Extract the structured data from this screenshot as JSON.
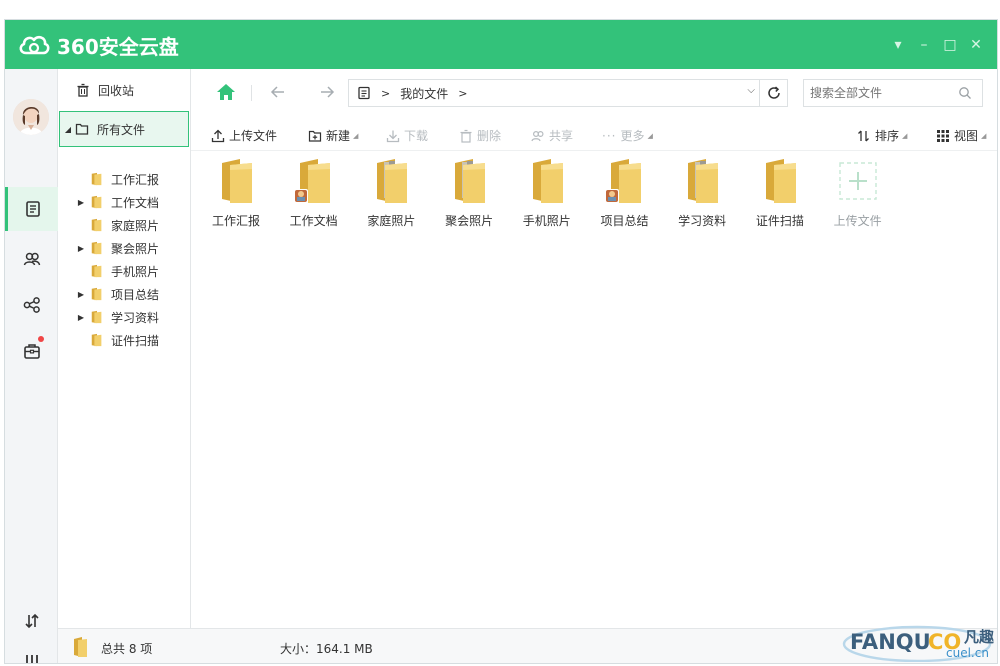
{
  "app": {
    "title": "360安全云盘"
  },
  "window": {
    "menu_glyph": "▾",
    "minimize_glyph": "–",
    "maximize_glyph": "□",
    "close_glyph": "✕"
  },
  "tree": {
    "recycle_bin": "回收站",
    "root": "所有文件",
    "items": [
      {
        "label": "工作汇报",
        "expandable": false
      },
      {
        "label": "工作文档",
        "expandable": true
      },
      {
        "label": "家庭照片",
        "expandable": false
      },
      {
        "label": "聚会照片",
        "expandable": true
      },
      {
        "label": "手机照片",
        "expandable": false
      },
      {
        "label": "项目总结",
        "expandable": true
      },
      {
        "label": "学习资料",
        "expandable": true
      },
      {
        "label": "证件扫描",
        "expandable": false
      }
    ]
  },
  "address": {
    "path_separator": ">",
    "current": "我的文件",
    "trailing_separator": ">",
    "search_placeholder": "搜索全部文件"
  },
  "toolbar": {
    "upload": "上传文件",
    "new": "新建",
    "download": "下载",
    "delete": "删除",
    "share": "共享",
    "more": "更多",
    "sort": "排序",
    "view": "视图"
  },
  "files": [
    {
      "name": "工作汇报",
      "variant": "plain"
    },
    {
      "name": "工作文档",
      "variant": "badge"
    },
    {
      "name": "家庭照片",
      "variant": "docs"
    },
    {
      "name": "聚会照片",
      "variant": "docs"
    },
    {
      "name": "手机照片",
      "variant": "plain"
    },
    {
      "name": "项目总结",
      "variant": "badge"
    },
    {
      "name": "学习资料",
      "variant": "docs"
    },
    {
      "name": "证件扫描",
      "variant": "plain"
    }
  ],
  "upload_tile": {
    "label": "上传文件"
  },
  "status": {
    "total": "总共 8 项",
    "size": "大小：164.1 MB"
  },
  "watermark": {
    "brand": "FANQU",
    "suffix": "CO",
    "domain": "cuel.cn",
    "cn": "凡趣"
  },
  "colors": {
    "accent": "#33c27a",
    "folder": "#f2cf6b",
    "folder_dark": "#d9a93a"
  }
}
